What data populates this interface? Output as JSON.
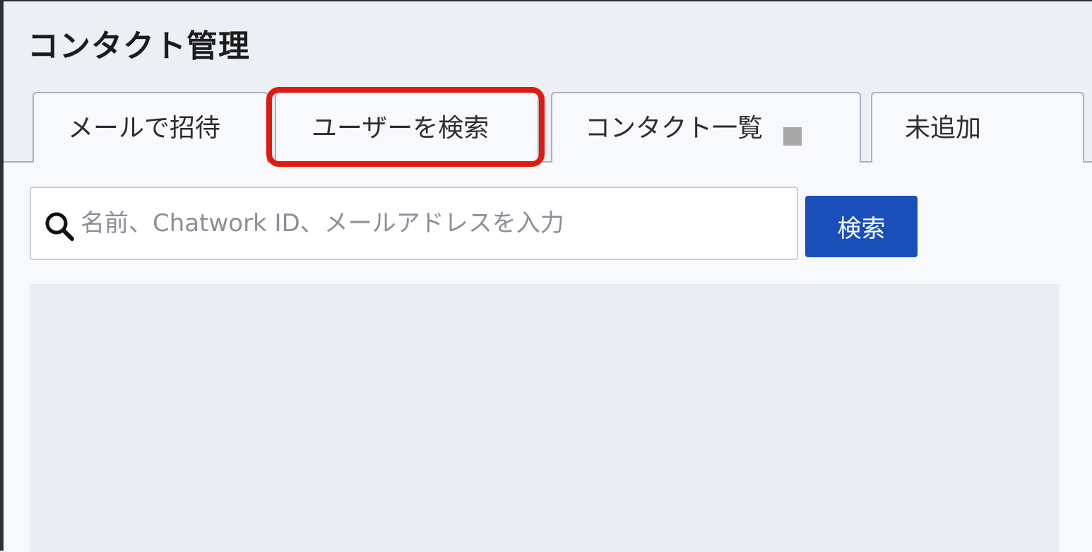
{
  "header": {
    "title": "コンタクト管理"
  },
  "tabs": [
    {
      "label": "メールで招待",
      "active": false
    },
    {
      "label": "ユーザーを検索",
      "active": true
    },
    {
      "label": "コンタクト一覧",
      "active": false
    },
    {
      "label": "未追加",
      "active": false
    }
  ],
  "search": {
    "placeholder": "名前、Chatwork ID、メールアドレスを入力",
    "value": "",
    "button_label": "検索"
  },
  "colors": {
    "accent": "#1a4fba",
    "highlight": "#e11a0f",
    "background": "#eceff4"
  }
}
